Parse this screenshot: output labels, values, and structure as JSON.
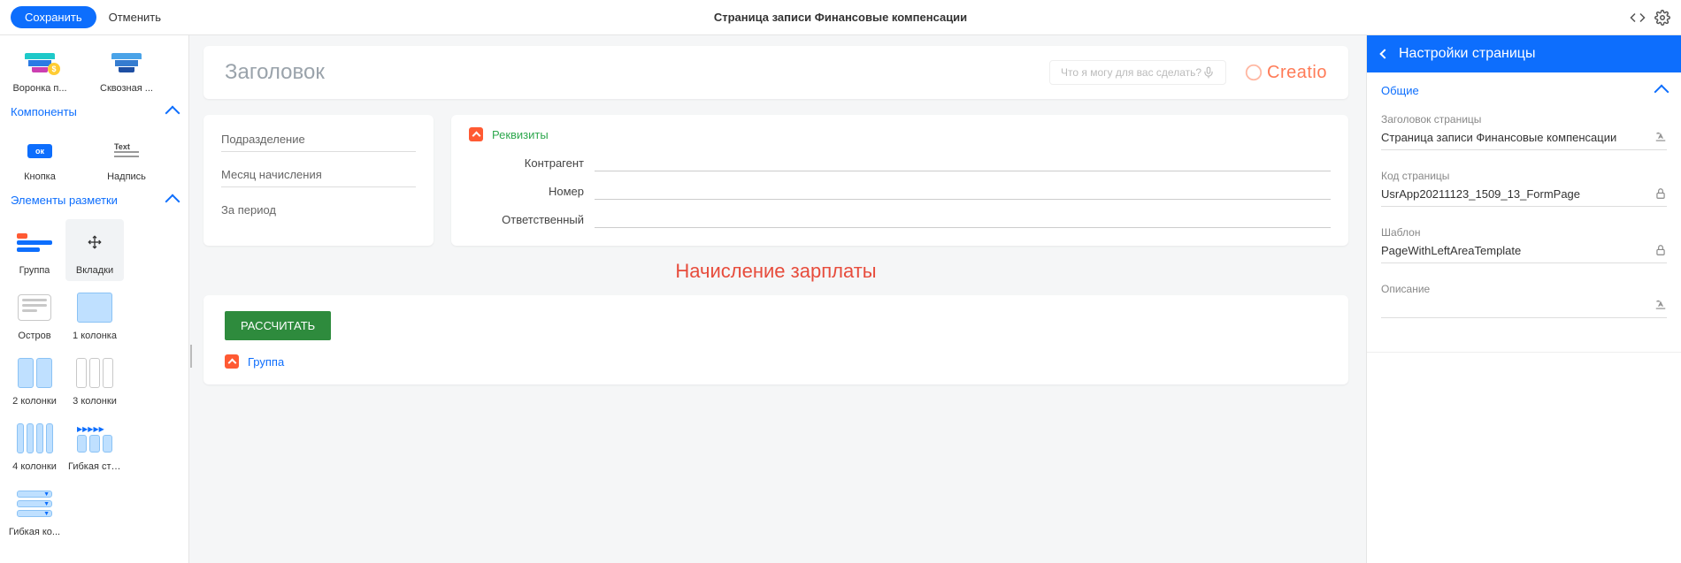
{
  "header": {
    "save": "Сохранить",
    "cancel": "Отменить",
    "title": "Страница записи Финансовые компенсации"
  },
  "palette": {
    "top": [
      {
        "label": "Воронка п..."
      },
      {
        "label": "Сквозная ..."
      }
    ],
    "sections": {
      "components": "Компоненты",
      "layout": "Элементы разметки"
    },
    "components": [
      {
        "label": "Кнопка",
        "chip": "ок"
      },
      {
        "label": "Надпись",
        "chip": "Text"
      }
    ],
    "layout": [
      {
        "label": "Группа"
      },
      {
        "label": "Вкладки"
      },
      {
        "label": "Остров"
      },
      {
        "label": "1 колонка"
      },
      {
        "label": "2 колонки"
      },
      {
        "label": "3 колонки"
      },
      {
        "label": "4 колонки"
      },
      {
        "label": "Гибкая стр..."
      },
      {
        "label": "Гибкая ко..."
      }
    ]
  },
  "canvas": {
    "title_placeholder": "Заголовок",
    "search_placeholder": "Что я могу для вас сделать?",
    "brand": "Creatio",
    "left_fields": [
      "Подразделение",
      "Месяц начисления",
      "За период"
    ],
    "req_group": "Реквизиты",
    "req_fields": [
      "Контрагент",
      "Номер",
      "Ответственный"
    ],
    "red_label": "Начисление зарплаты",
    "calc_button": "РАССЧИТАТЬ",
    "group_label": "Группа"
  },
  "settings": {
    "panel_title": "Настройки страницы",
    "section_general": "Общие",
    "fields": {
      "page_title": {
        "label": "Заголовок страницы",
        "value": "Страница записи Финансовые компенсации"
      },
      "page_code": {
        "label": "Код страницы",
        "value": "UsrApp20211123_1509_13_FormPage"
      },
      "template": {
        "label": "Шаблон",
        "value": "PageWithLeftAreaTemplate"
      },
      "description": {
        "label": "Описание",
        "value": ""
      }
    }
  }
}
